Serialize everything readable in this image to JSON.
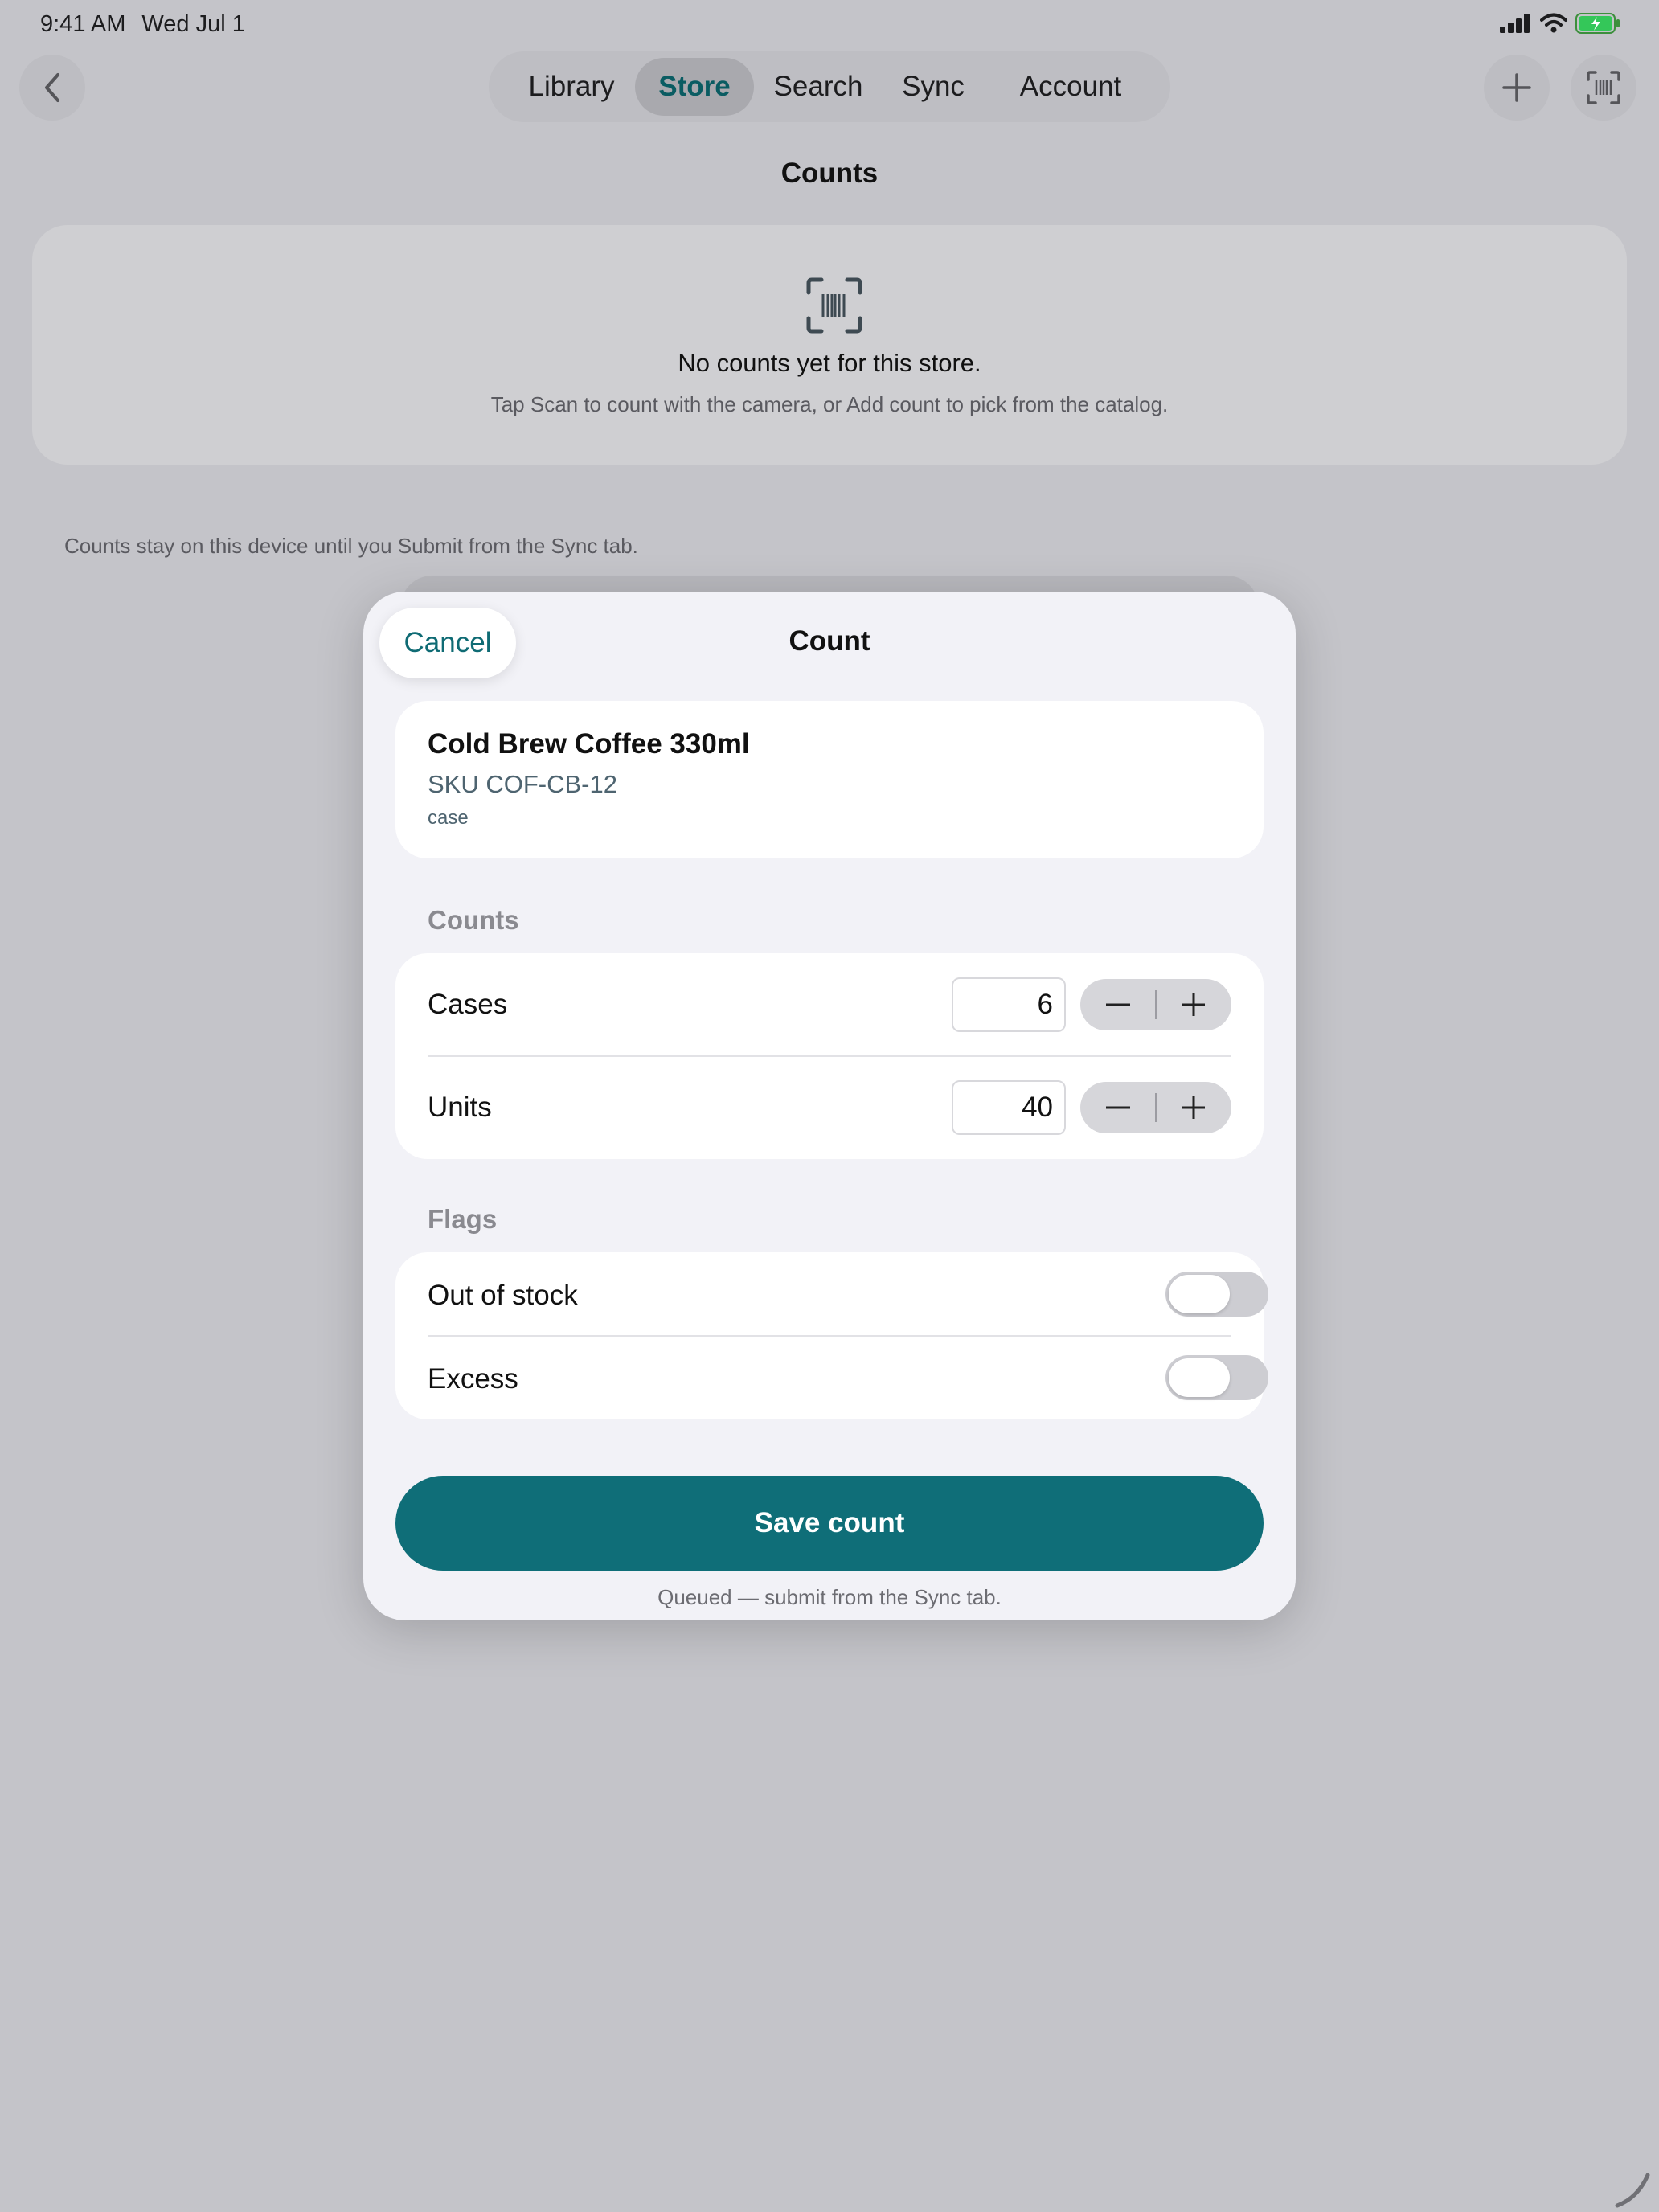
{
  "status_bar": {
    "time": "9:41 AM",
    "date": "Wed Jul 1"
  },
  "tabs": [
    {
      "label": "Library",
      "active": false
    },
    {
      "label": "Store",
      "active": true
    },
    {
      "label": "Search",
      "active": false
    },
    {
      "label": "Sync",
      "active": false
    },
    {
      "label": "Account",
      "active": false
    }
  ],
  "page": {
    "title": "Counts",
    "empty_title": "No counts yet for this store.",
    "empty_subtitle": "Tap Scan to count with the camera, or Add count to pick from the catalog.",
    "footnote": "Counts stay on this device until you Submit from the Sync tab."
  },
  "sheet": {
    "title": "Count",
    "cancel_label": "Cancel",
    "product": {
      "name": "Cold Brew Coffee 330ml",
      "sku": "SKU COF-CB-12",
      "unit": "case"
    },
    "counts_section": "Counts",
    "counts": [
      {
        "label": "Cases",
        "value": "6"
      },
      {
        "label": "Units",
        "value": "40"
      }
    ],
    "flags_section": "Flags",
    "flags": [
      {
        "label": "Out of stock",
        "on": false
      },
      {
        "label": "Excess",
        "on": false
      }
    ],
    "save_label": "Save count",
    "queued_note": "Queued — submit from the Sync tab."
  },
  "colors": {
    "accent": "#0f6e78",
    "background": "#c4c4c9",
    "sheet": "#f2f2f7"
  },
  "icons": [
    "back-chevron-icon",
    "plus-icon",
    "barcode-scan-icon",
    "minus-icon",
    "signal-icon",
    "wifi-icon",
    "battery-icon"
  ]
}
